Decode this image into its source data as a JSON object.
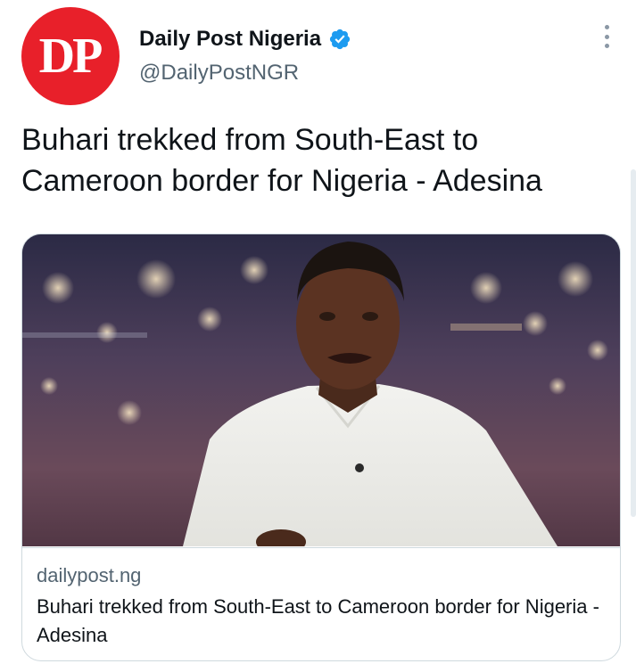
{
  "author": {
    "avatar_text": "DP",
    "display_name": "Daily Post Nigeria",
    "handle": "@DailyPostNGR",
    "verified": true
  },
  "tweet": {
    "text": "Buhari trekked from South-East to Cameroon border for Nigeria - Adesina"
  },
  "card": {
    "domain": "dailypost.ng",
    "title": "Buhari trekked from South-East to Cameroon border for Nigeria - Adesina"
  },
  "colors": {
    "brand_red": "#e8202a",
    "verified_blue": "#1d9bf0",
    "secondary_text": "#536471"
  },
  "icons": {
    "verified": "verified-badge-icon",
    "more": "more-options-icon"
  }
}
